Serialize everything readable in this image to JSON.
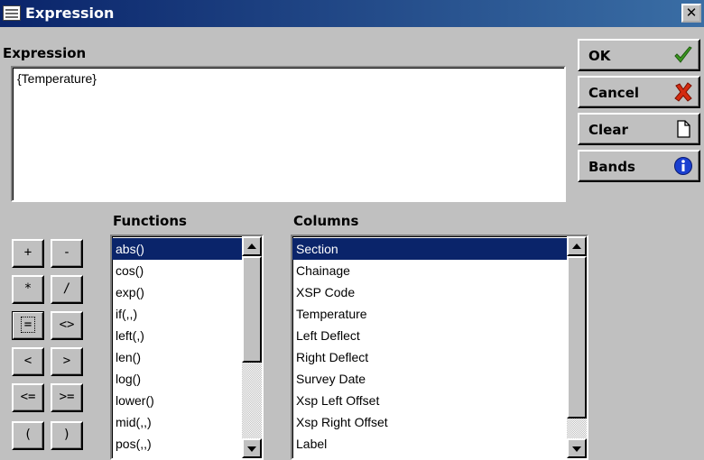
{
  "window": {
    "title": "Expression",
    "close_label": "✕"
  },
  "expression": {
    "section_label": "Expression",
    "value": "{Temperature}"
  },
  "buttons": {
    "ok": {
      "label": "OK",
      "icon": "check-icon",
      "color": "#3c9a20"
    },
    "cancel": {
      "label": "Cancel",
      "icon": "x-icon",
      "color": "#d42a10"
    },
    "clear": {
      "label": "Clear",
      "icon": "document-icon"
    },
    "bands": {
      "label": "Bands",
      "icon": "info-icon",
      "color": "#1a3fd0"
    }
  },
  "operators": [
    "+",
    "-",
    "*",
    "/",
    "=",
    "<>",
    "<",
    ">",
    "<=",
    ">=",
    "(",
    ")"
  ],
  "functions": {
    "label": "Functions",
    "selected_index": 0,
    "items": [
      "abs()",
      "cos()",
      "exp()",
      "if(,,)",
      "left(,)",
      "len()",
      "log()",
      "lower()",
      "mid(,,)",
      "pos(,,)"
    ]
  },
  "columns": {
    "label": "Columns",
    "selected_index": 0,
    "items": [
      "Section",
      "Chainage",
      "XSP Code",
      "Temperature",
      "Left Deflect",
      "Right Deflect",
      "Survey Date",
      "Xsp Left Offset",
      "Xsp Right Offset",
      "Label"
    ]
  }
}
